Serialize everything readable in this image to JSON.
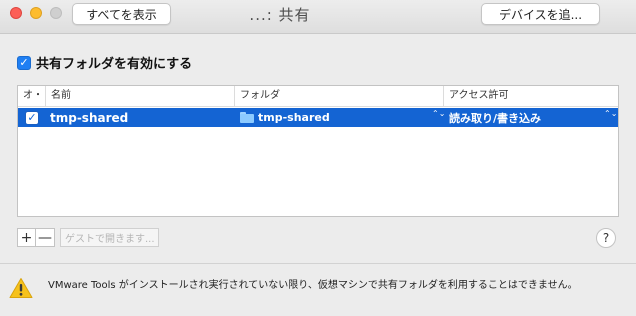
{
  "window": {
    "title": "...: 共有",
    "show_all_label": "すべてを表示",
    "add_device_label": "デバイスを追..."
  },
  "sharing": {
    "enable_label": "共有フォルダを有効にする",
    "enabled": true
  },
  "table": {
    "headers": [
      "オ・",
      "名前",
      "フォルダ",
      "アクセス許可"
    ],
    "rows": [
      {
        "checked": true,
        "check_glyph": "✓",
        "name": "tmp-shared",
        "folder": "tmp-shared",
        "permission": "読み取り/書き込み",
        "chevron": "⌃⌄"
      }
    ]
  },
  "controls": {
    "add_label": "+",
    "remove_label": "—",
    "open_in_guest_label": "ゲストで開きます...",
    "help_label": "?"
  },
  "warning": {
    "text": "VMware Tools がインストールされ実行されていない限り、仮想マシンで共有フォルダを利用することはできません。"
  },
  "colors": {
    "accent": "#1464d3",
    "checkbox": "#1f7ff3",
    "warning": "#f6c21c"
  }
}
